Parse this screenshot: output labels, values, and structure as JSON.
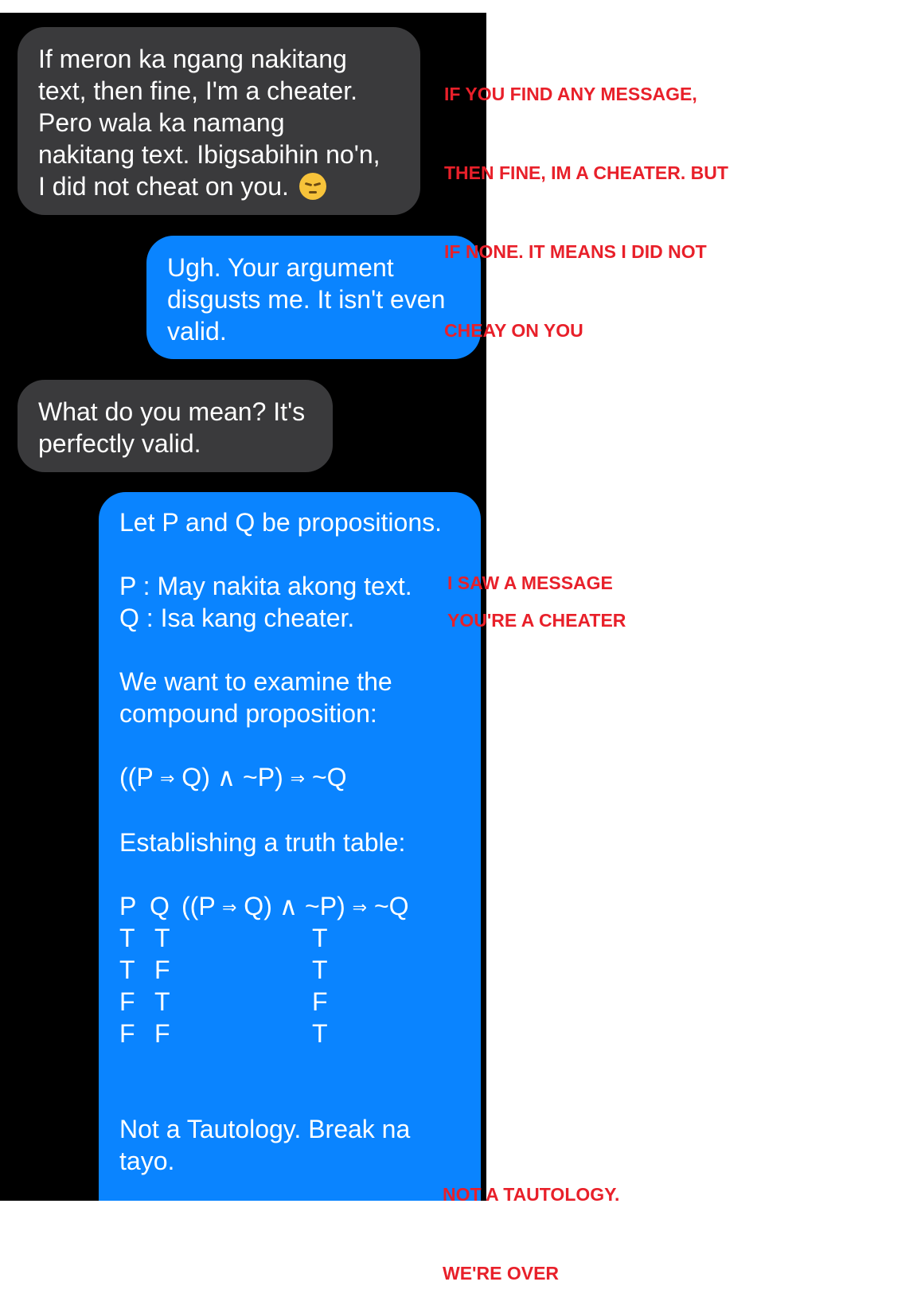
{
  "messages": {
    "m1": {
      "lines": [
        "If meron ka ngang nakitang",
        "text, then fine, I'm a cheater.",
        "Pero wala ka namang",
        "nakitang text. Ibigsabihin no'n,",
        "I did not cheat on you."
      ],
      "emoji": "pensive-face"
    },
    "m2": {
      "lines": [
        "Ugh. Your argument",
        "disgusts me. It isn't even",
        "valid."
      ]
    },
    "m3": {
      "lines": [
        "What do you mean? It's",
        "perfectly valid."
      ]
    },
    "m4": {
      "intro": "Let P and Q be propositions.",
      "p_def": "P : May nakita akong text.",
      "q_def": "Q : Isa kang cheater.",
      "examine_1": "We want to examine the",
      "examine_2": "compound proposition:",
      "formula": {
        "open": "((P",
        "arrow": "⇒",
        "mid": "Q) ∧ ~P)",
        "end": "~Q"
      },
      "table_title": "Establishing a truth table:",
      "truth_table": {
        "headers": [
          "P",
          "Q"
        ],
        "rows": [
          [
            "T",
            "T",
            "T"
          ],
          [
            "T",
            "F",
            "T"
          ],
          [
            "F",
            "T",
            "F"
          ],
          [
            "F",
            "F",
            "T"
          ]
        ]
      },
      "conclusion_1": "Not a Tautology. Break na",
      "conclusion_2": "tayo."
    }
  },
  "annotations": {
    "a1": [
      "IF YOU FIND ANY MESSAGE,",
      "THEN FINE, IM A CHEATER. BUT",
      "IF NONE. IT MEANS I DID NOT",
      "CHEAY ON YOU"
    ],
    "a2": "I SAW A MESSAGE",
    "a3": "YOU'RE A CHEATER",
    "a4": [
      "NOT A TAUTOLOGY.",
      "WE'RE OVER"
    ]
  },
  "colors": {
    "incoming_bubble": "#3a3a3c",
    "outgoing_bubble": "#0a84ff",
    "annotation_red": "#e8202a"
  }
}
